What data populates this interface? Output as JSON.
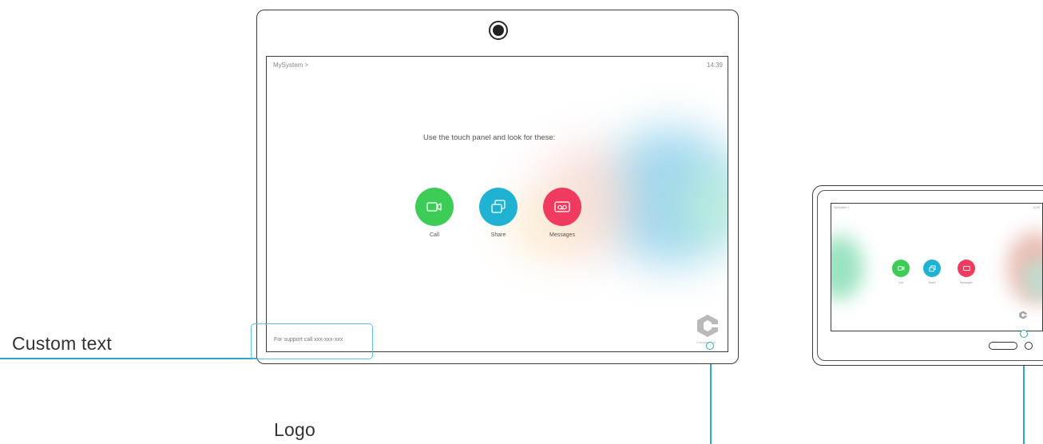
{
  "callouts": {
    "custom_text": "Custom text",
    "logo": "Logo"
  },
  "main_screen": {
    "title": "MySystem >",
    "clock": "14:39",
    "prompt": "Use the touch panel and look for these:",
    "buttons": [
      {
        "label": "Call",
        "color": "#3dcc55",
        "icon": "video-icon"
      },
      {
        "label": "Share",
        "color": "#1fb2d3",
        "icon": "share-icon"
      },
      {
        "label": "Messages",
        "color": "#f03a5f",
        "icon": "voicemail-icon"
      }
    ],
    "support_text": "For support call xxx-xxx-xxx",
    "logo_caption": "Company Ltd.",
    "logo_icon": "company-logo"
  },
  "touch_panel": {
    "title": "MySystem >",
    "clock": "14:39",
    "buttons": [
      {
        "label": "Call",
        "color": "#3dcc55"
      },
      {
        "label": "Share",
        "color": "#1fb2d3"
      },
      {
        "label": "Messages",
        "color": "#f03a5f"
      }
    ],
    "logo_icon": "company-logo"
  },
  "colors": {
    "callout_line": "#2fa6c9",
    "highlight": "#60c2de",
    "frame": "#3b3b3b"
  }
}
